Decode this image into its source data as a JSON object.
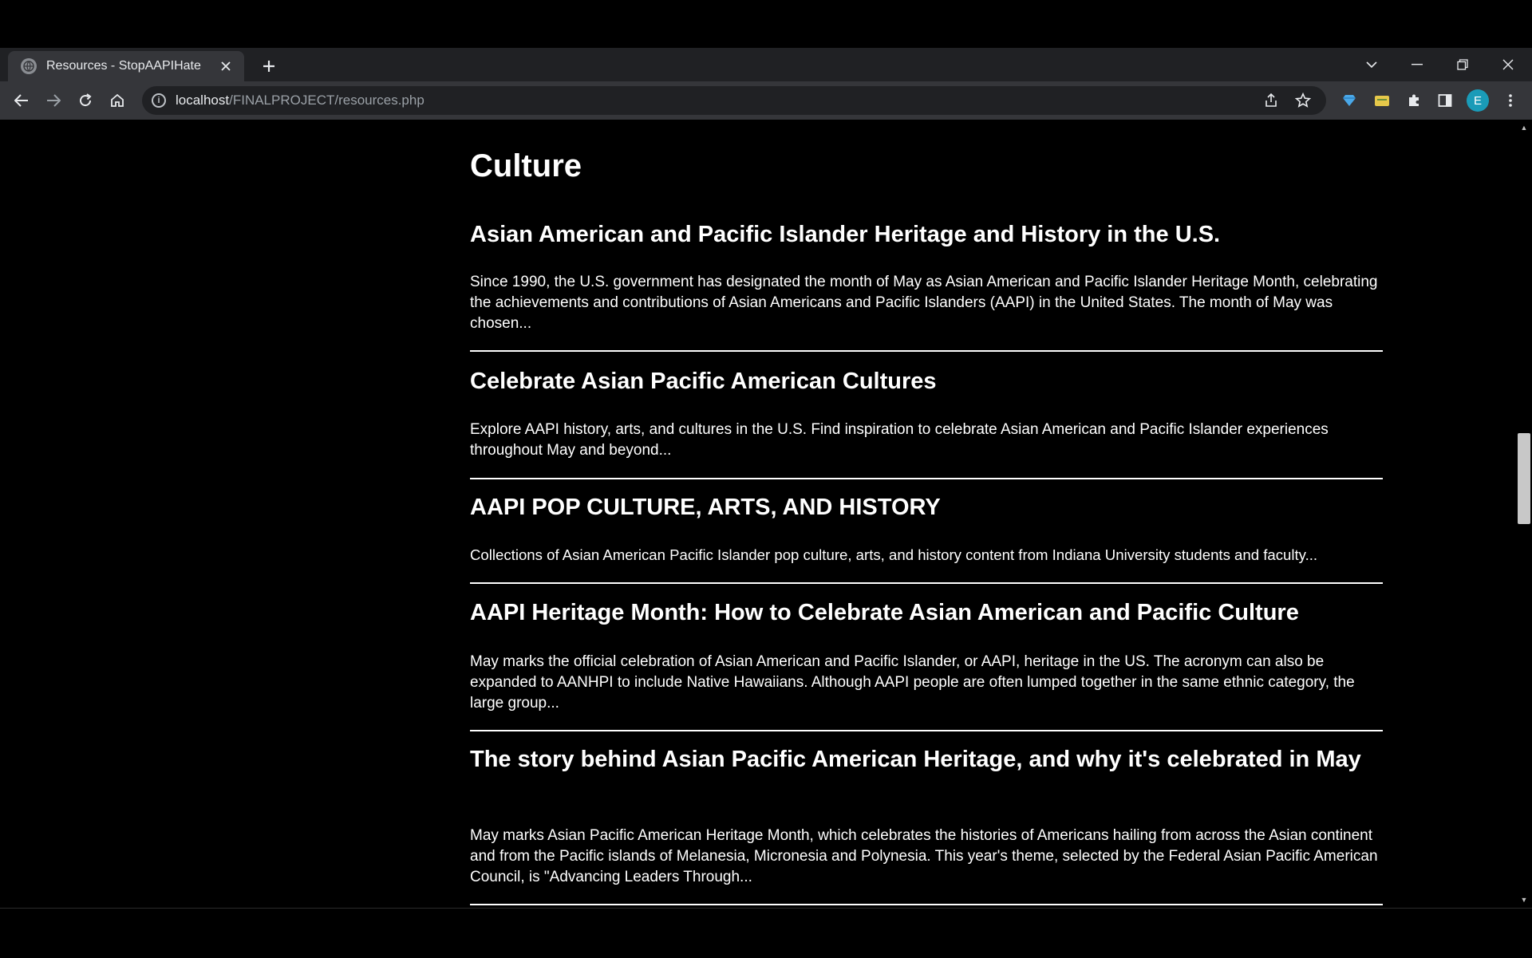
{
  "browser": {
    "tab_title": "Resources - StopAAPIHate",
    "url_host": "localhost",
    "url_path": "/FINALPROJECT/resources.php",
    "profile_initial": "E"
  },
  "page": {
    "section_title": "Culture",
    "articles": [
      {
        "title": "Asian American and Pacific Islander Heritage and History in the U.S.",
        "summary": "Since 1990, the U.S. government has designated the month of May as Asian American and Pacific Islander Heritage Month, celebrating the achievements and contributions of Asian Americans and Pacific Islanders (AAPI) in the United States. The month of May was chosen..."
      },
      {
        "title": "Celebrate Asian Pacific American Cultures",
        "summary": "Explore AAPI history, arts, and cultures in the U.S. Find inspiration to celebrate Asian American and Pacific Islander experiences throughout May and beyond..."
      },
      {
        "title": "AAPI POP CULTURE, ARTS, AND HISTORY",
        "summary": "Collections of Asian American Pacific Islander pop culture, arts, and history content from Indiana University students and faculty..."
      },
      {
        "title": "AAPI Heritage Month: How to Celebrate Asian American and Pacific Culture",
        "summary": "May marks the official celebration of Asian American and Pacific Islander, or AAPI, heritage in the US. The acronym can also be expanded to AANHPI to include Native Hawaiians. Although AAPI people are often lumped together in the same ethnic category, the large group..."
      },
      {
        "title": "The story behind Asian Pacific American Heritage, and why it's celebrated in May",
        "summary": "May marks Asian Pacific American Heritage Month, which celebrates the histories of Americans hailing from across the Asian continent and from the Pacific islands of Melanesia, Micronesia and Polynesia. This year's theme, selected by the Federal Asian Pacific American Council, is \"Advancing Leaders Through..."
      }
    ]
  },
  "icons": {
    "favicon": "globe-icon",
    "close": "close-icon",
    "new_tab": "plus-icon",
    "back": "back-arrow-icon",
    "forward": "forward-arrow-icon",
    "reload": "reload-icon",
    "home": "home-icon",
    "site_info": "info-icon",
    "share": "share-icon",
    "bookmark": "star-icon",
    "extensions": "puzzle-icon",
    "side_panel": "side-panel-icon",
    "menu": "kebab-menu-icon"
  }
}
